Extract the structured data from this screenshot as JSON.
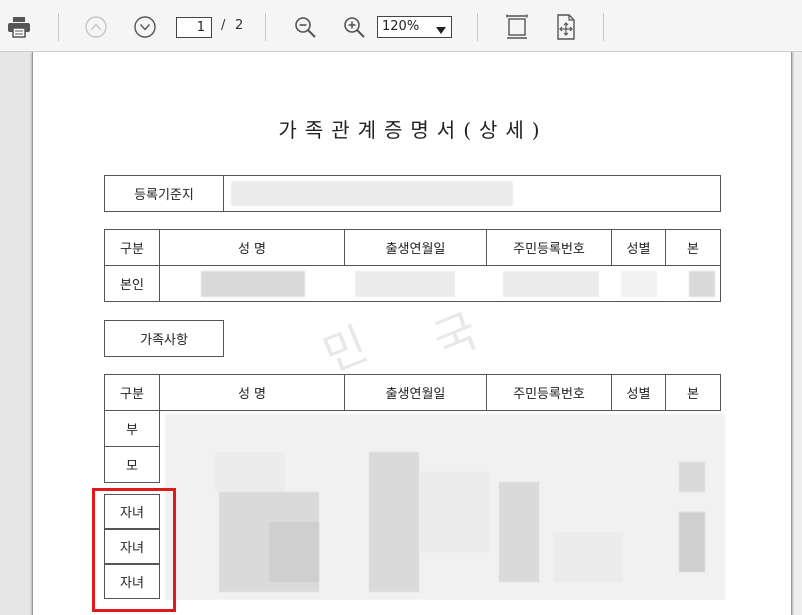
{
  "toolbar": {
    "page_current": "1",
    "page_separator": "/",
    "page_total": "2",
    "zoom_value": "120%"
  },
  "document": {
    "title": "가족관계증명서(상세)",
    "registry_label": "등록기준지",
    "section_family_label": "가족사항",
    "headers": {
      "category": "구분",
      "name": "성   명",
      "birth": "출생연월일",
      "resident_number": "주민등록번호",
      "gender": "성별",
      "origin": "본"
    },
    "self_label": "본인",
    "family_rows": [
      "부",
      "모",
      "자녀",
      "자녀",
      "자녀"
    ],
    "watermark_chars": [
      "민",
      "국"
    ]
  },
  "colors": {
    "highlight": "#e01b1b"
  }
}
